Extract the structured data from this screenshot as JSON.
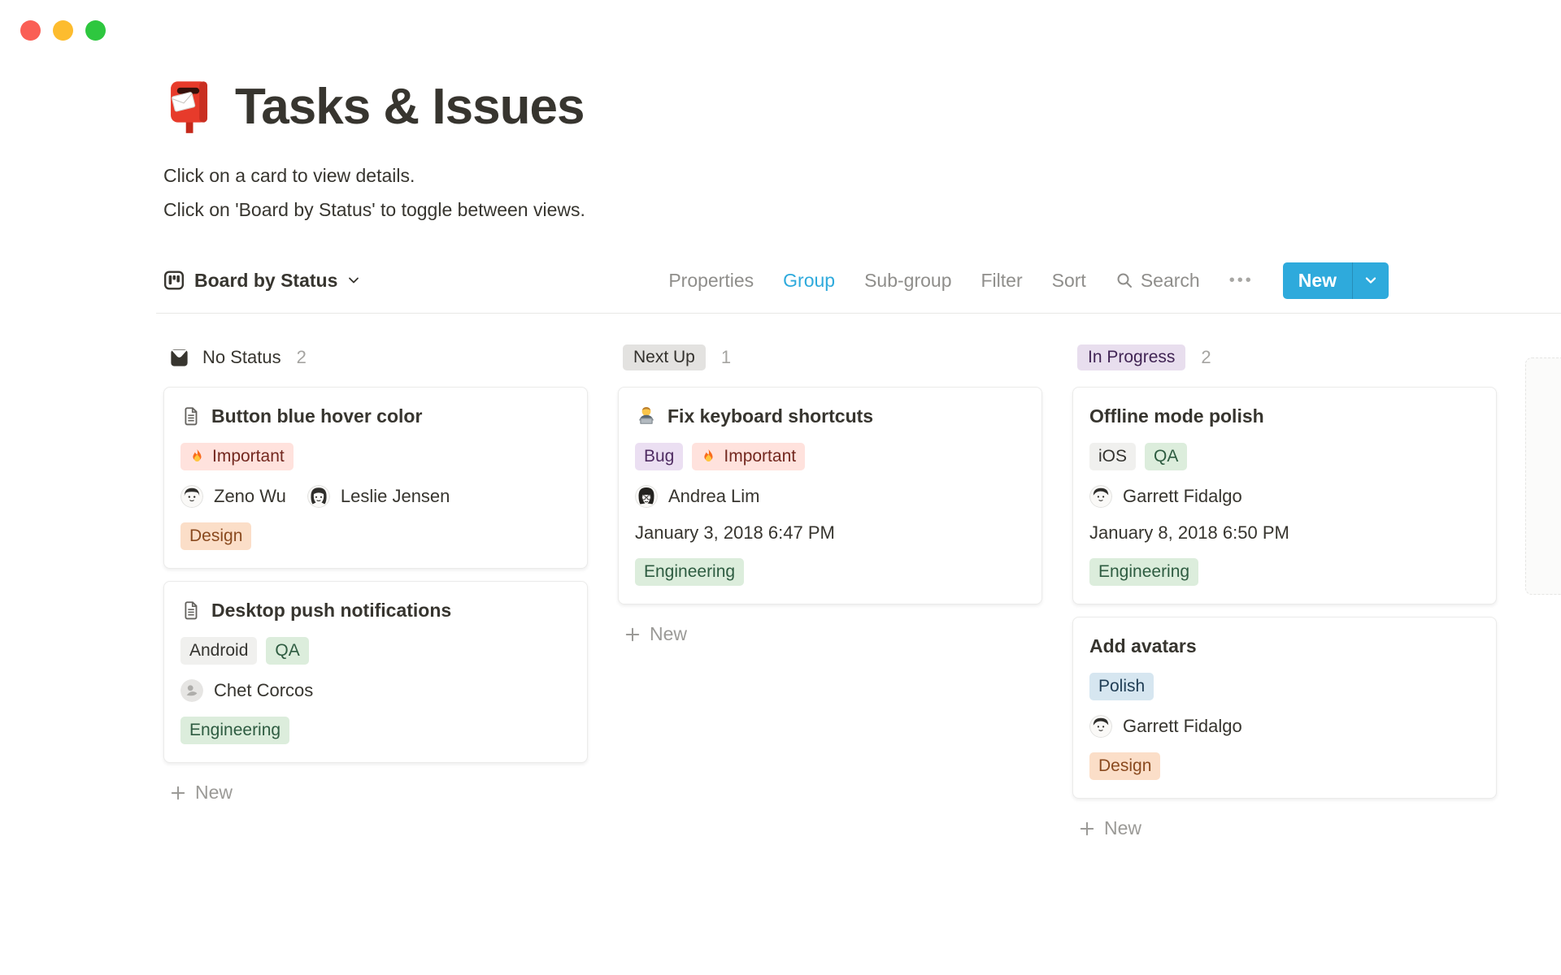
{
  "window": {
    "controls": [
      {
        "name": "close-button",
        "color": "#FA5F55"
      },
      {
        "name": "minimize-button",
        "color": "#FDBC2E"
      },
      {
        "name": "zoom-button",
        "color": "#2EC73F"
      }
    ]
  },
  "header": {
    "icon": "postbox-emoji",
    "title": "Tasks & Issues",
    "subtitle_line1": "Click on a card to view details.",
    "subtitle_line2": "Click on 'Board by Status' to toggle between views."
  },
  "toolbar": {
    "view": {
      "icon": "board-icon",
      "label": "Board by Status"
    },
    "menu": [
      {
        "label": "Properties",
        "active": false
      },
      {
        "label": "Group",
        "active": true
      },
      {
        "label": "Sub-group",
        "active": false
      },
      {
        "label": "Filter",
        "active": false
      },
      {
        "label": "Sort",
        "active": false
      }
    ],
    "search": {
      "icon": "search-icon",
      "label": "Search"
    },
    "more_label": "•••",
    "new_button": {
      "label": "New",
      "color": "#2EAADC"
    }
  },
  "colors": {
    "accent_blue": "#2EAADC",
    "tag_red_bg": "#FFE2DD",
    "tag_orange_bg": "#FBDEC8",
    "tag_green_bg": "#DCEDDC",
    "tag_gray_bg": "#F0F0EE",
    "tag_purple_bg": "#EBDFF2",
    "tag_blue_bg": "#D6E6F0",
    "pill_gray_bg": "#E3E2E0",
    "pill_purple_bg": "#E8DEEE"
  },
  "board": {
    "columns": [
      {
        "id": "no-status",
        "header": {
          "icon": "inbox-icon",
          "label": "No Status",
          "pill": null,
          "count": "2"
        },
        "cards": [
          {
            "icon": "document-icon",
            "title": "Button blue hover color",
            "rows": [
              {
                "type": "tags",
                "tags": [
                  {
                    "label": "Important",
                    "color": "red",
                    "icon": "fire-emoji"
                  }
                ]
              },
              {
                "type": "people",
                "people": [
                  {
                    "name": "Zeno Wu",
                    "avatar": "zeno"
                  },
                  {
                    "name": "Leslie Jensen",
                    "avatar": "leslie"
                  }
                ]
              },
              {
                "type": "tags",
                "tags": [
                  {
                    "label": "Design",
                    "color": "orange"
                  }
                ]
              }
            ]
          },
          {
            "icon": "document-icon",
            "title": "Desktop push notifications",
            "rows": [
              {
                "type": "tags",
                "tags": [
                  {
                    "label": "Android",
                    "color": "gray"
                  },
                  {
                    "label": "QA",
                    "color": "green"
                  }
                ]
              },
              {
                "type": "people",
                "people": [
                  {
                    "name": "Chet Corcos",
                    "avatar": "placeholder"
                  }
                ]
              },
              {
                "type": "tags",
                "tags": [
                  {
                    "label": "Engineering",
                    "color": "green"
                  }
                ]
              }
            ]
          }
        ],
        "new_label": "New"
      },
      {
        "id": "next-up",
        "header": {
          "icon": null,
          "label": "Next Up",
          "pill": "gray",
          "count": "1"
        },
        "cards": [
          {
            "icon": "technologist-emoji",
            "title": "Fix keyboard shortcuts",
            "rows": [
              {
                "type": "tags",
                "tags": [
                  {
                    "label": "Bug",
                    "color": "purple"
                  },
                  {
                    "label": "Important",
                    "color": "red",
                    "icon": "fire-emoji"
                  }
                ]
              },
              {
                "type": "people",
                "people": [
                  {
                    "name": "Andrea Lim",
                    "avatar": "andrea"
                  }
                ]
              },
              {
                "type": "date",
                "text": "January 3, 2018 6:47 PM"
              },
              {
                "type": "tags",
                "tags": [
                  {
                    "label": "Engineering",
                    "color": "green"
                  }
                ]
              }
            ]
          }
        ],
        "new_label": "New"
      },
      {
        "id": "in-progress",
        "header": {
          "icon": null,
          "label": "In Progress",
          "pill": "purple",
          "count": "2"
        },
        "cards": [
          {
            "icon": null,
            "title": "Offline mode polish",
            "rows": [
              {
                "type": "tags",
                "tags": [
                  {
                    "label": "iOS",
                    "color": "gray"
                  },
                  {
                    "label": "QA",
                    "color": "green"
                  }
                ]
              },
              {
                "type": "people",
                "people": [
                  {
                    "name": "Garrett Fidalgo",
                    "avatar": "garrett"
                  }
                ]
              },
              {
                "type": "date",
                "text": "January 8, 2018 6:50 PM"
              },
              {
                "type": "tags",
                "tags": [
                  {
                    "label": "Engineering",
                    "color": "green"
                  }
                ]
              }
            ]
          },
          {
            "icon": null,
            "title": "Add avatars",
            "rows": [
              {
                "type": "tags",
                "tags": [
                  {
                    "label": "Polish",
                    "color": "blue"
                  }
                ]
              },
              {
                "type": "people",
                "people": [
                  {
                    "name": "Garrett Fidalgo",
                    "avatar": "garrett"
                  }
                ]
              },
              {
                "type": "tags",
                "tags": [
                  {
                    "label": "Design",
                    "color": "orange"
                  }
                ]
              }
            ]
          }
        ],
        "new_label": "New"
      }
    ]
  }
}
